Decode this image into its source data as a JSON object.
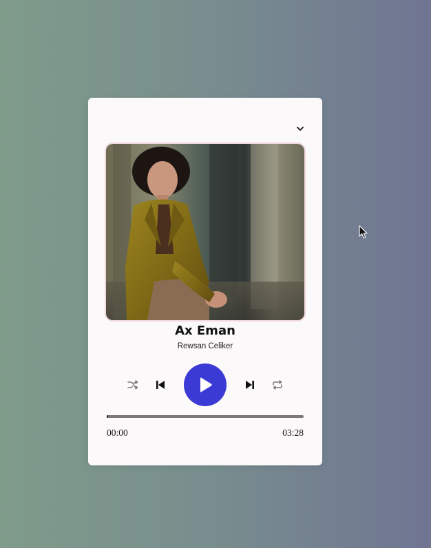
{
  "player": {
    "title": "Ax Eman",
    "artist": "Rewsan Celiker",
    "current_time": "00:00",
    "total_time": "03:28",
    "progress": 0.0,
    "play_state": "paused"
  },
  "icons": {
    "collapse": "chevron-down-icon",
    "shuffle": "shuffle-icon",
    "previous": "skip-previous-icon",
    "play": "play-icon",
    "next": "skip-next-icon",
    "repeat": "repeat-icon"
  },
  "colors": {
    "accent": "#3c3ad4",
    "card": "#fcf9fa",
    "track": "#7a7a7a"
  }
}
